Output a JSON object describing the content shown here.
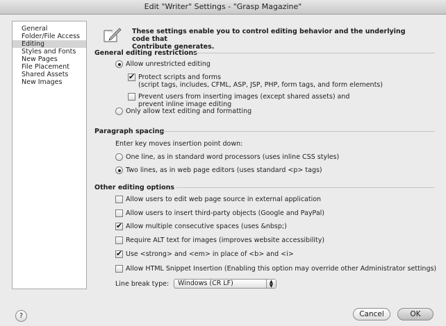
{
  "window": {
    "title": "Edit \"Writer\" Settings - \"Grasp Magazine\""
  },
  "sidebar": {
    "items": [
      {
        "label": "General"
      },
      {
        "label": "Folder/File Access"
      },
      {
        "label": "Editing"
      },
      {
        "label": "Styles and Fonts"
      },
      {
        "label": "New Pages"
      },
      {
        "label": "File Placement"
      },
      {
        "label": "Shared Assets"
      },
      {
        "label": "New Images"
      }
    ],
    "selected_index": 2
  },
  "header": {
    "line1": "These settings enable you to control editing behavior and the underlying code that",
    "line2": "Contribute generates.",
    "icon": "pencil-paper-icon"
  },
  "general": {
    "title": "General editing restrictions",
    "allow_unrestricted": "Allow unrestricted editing",
    "protect_scripts": "Protect scripts and forms",
    "protect_scripts_detail": "(script tags, includes, CFML, ASP, JSP, PHP, form tags, and form elements)",
    "prevent_images": "Prevent users from inserting images (except shared assets) and",
    "prevent_images_2": "prevent inline image editing",
    "only_text": "Only allow text editing and formatting"
  },
  "paragraph": {
    "title": "Paragraph spacing",
    "prompt": "Enter key moves insertion point down:",
    "one_line": "One line, as in standard word processors (uses inline CSS styles)",
    "two_lines": "Two lines, as in web page editors (uses standard <p> tags)"
  },
  "other": {
    "title": "Other editing options",
    "opt1": "Allow users to edit web page source in external application",
    "opt2": "Allow users to insert third-party objects (Google and PayPal)",
    "opt3": "Allow multiple consecutive spaces (uses &nbsp;)",
    "opt4": "Require ALT text for images (improves website accessibility)",
    "opt5": "Use <strong> and <em> in place of <b> and <i>",
    "opt6": "Allow HTML Snippet Insertion (Enabling this option may override other Administrator settings)",
    "line_break_label": "Line break type:",
    "line_break_value": "Windows (CR LF)"
  },
  "footer": {
    "help": "?",
    "cancel": "Cancel",
    "ok": "OK"
  }
}
